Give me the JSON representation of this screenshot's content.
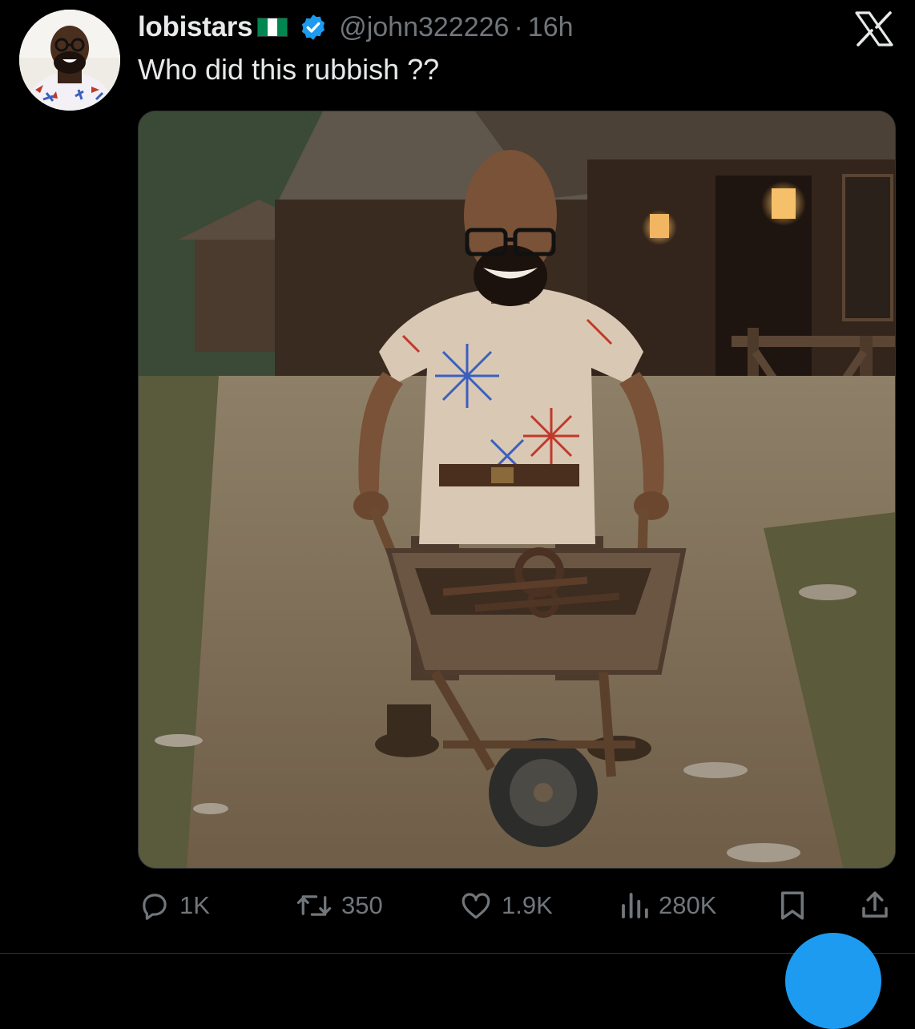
{
  "post": {
    "author": {
      "display_name": "lobistars",
      "flag_emoji": "🇳🇬",
      "flag_colors": [
        "#008751",
        "#ffffff",
        "#008751"
      ],
      "verified": true,
      "verified_color": "#1d9bf0",
      "handle": "@john322226",
      "separator": "·",
      "time_ago": "16h",
      "avatar_icon": "profile-avatar"
    },
    "text": "Who did this rubbish ??",
    "media": {
      "type": "image",
      "scene": "bald-man-with-glasses-pushing-rusty-wheelbarrow-on-village-dirt-road"
    }
  },
  "actions": {
    "reply": {
      "icon": "reply-icon",
      "count": "1K"
    },
    "repost": {
      "icon": "repost-icon",
      "count": "350"
    },
    "like": {
      "icon": "heart-icon",
      "count": "1.9K"
    },
    "views": {
      "icon": "views-icon",
      "count": "280K"
    },
    "bookmark": {
      "icon": "bookmark-icon"
    },
    "share": {
      "icon": "share-icon"
    }
  },
  "close": {
    "icon": "x-logo-icon"
  },
  "fab": {
    "icon": "compose-icon",
    "color": "#1d9bf0"
  },
  "colors": {
    "background": "#000000",
    "text_primary": "#e7e9ea",
    "text_secondary": "#71767b",
    "accent": "#1d9bf0"
  }
}
